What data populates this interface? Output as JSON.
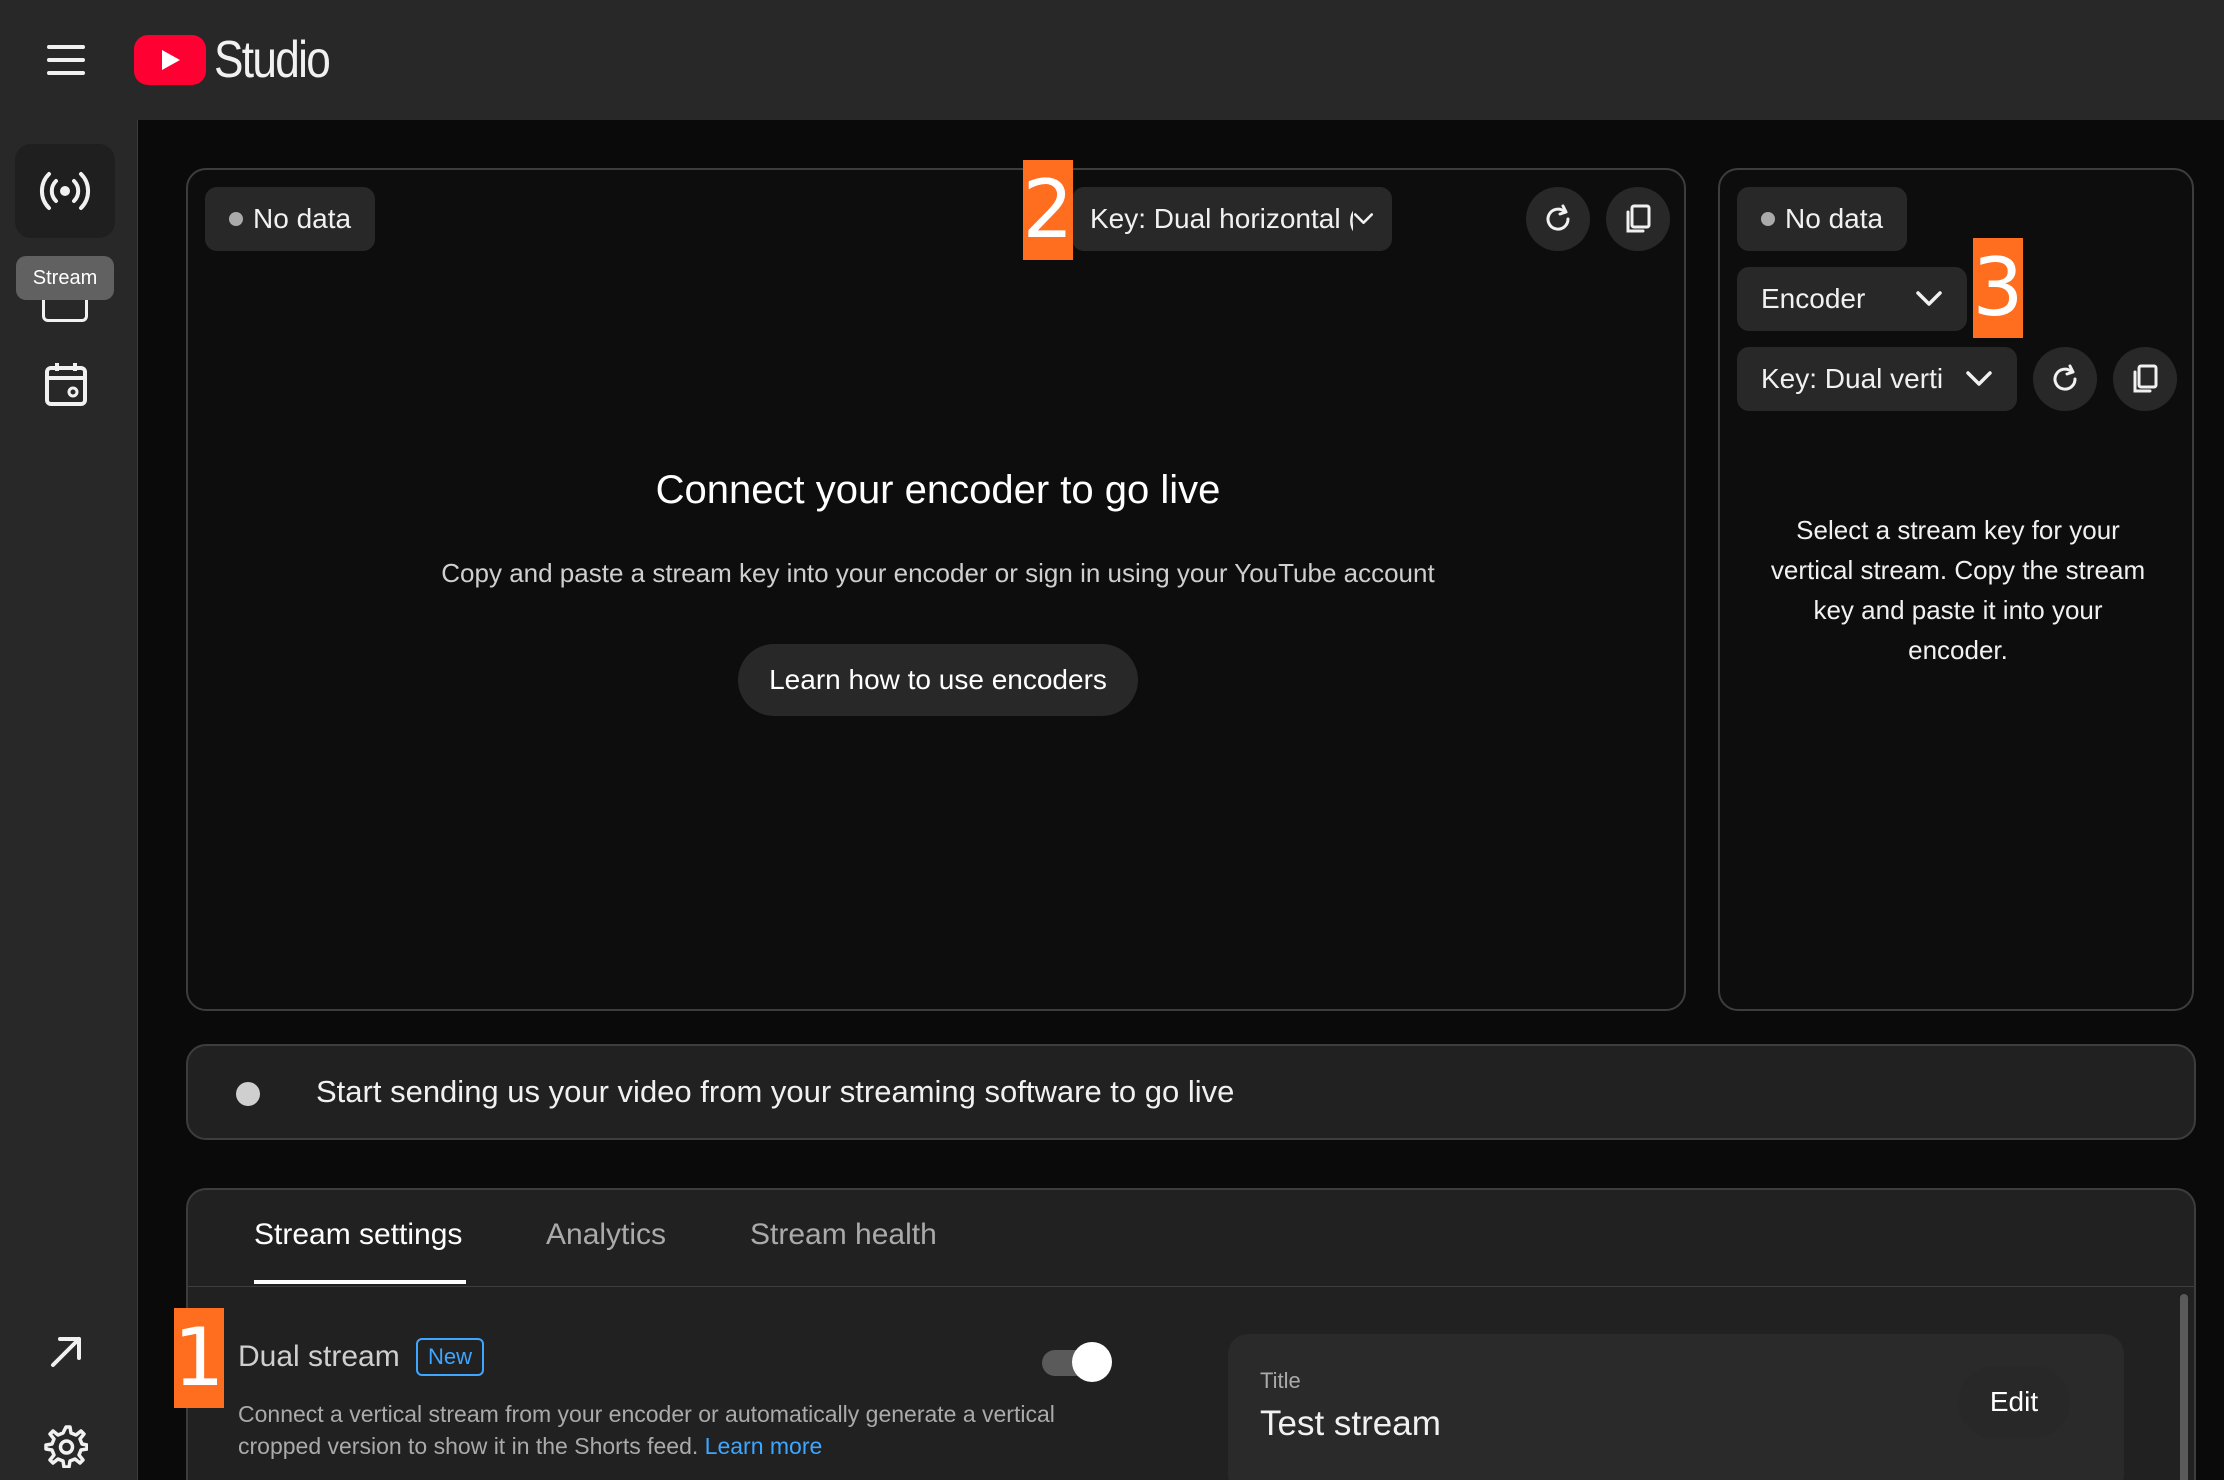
{
  "app": {
    "logo_text": "Studio"
  },
  "sidebar": {
    "tooltip": "Stream"
  },
  "preview_main": {
    "health_chip": "No data",
    "key_select": "Key: Dual horizontal (RTMP,",
    "title": "Connect your encoder to go live",
    "subtitle": "Copy and paste a stream key into your encoder or sign in using your YouTube account",
    "learn_button": "Learn how to use encoders"
  },
  "preview_vertical": {
    "health_chip": "No data",
    "source_select": "Encoder",
    "key_select": "Key: Dual verti",
    "message": "Select a stream key for your vertical stream. Copy the stream key and paste it into your encoder."
  },
  "status": {
    "message": "Start sending us your video from your streaming software to go live"
  },
  "tabs": [
    {
      "label": "Stream settings",
      "active": true
    },
    {
      "label": "Analytics",
      "active": false
    },
    {
      "label": "Stream health",
      "active": false
    }
  ],
  "dual_stream": {
    "label": "Dual stream",
    "badge": "New",
    "enabled": true,
    "description": "Connect a vertical stream from your encoder or automatically generate a vertical cropped version to show it in the Shorts feed.",
    "learn_more": "Learn more"
  },
  "details": {
    "title_label": "Title",
    "title_value": "Test stream",
    "edit_label": "Edit"
  },
  "annotations": {
    "one": "1",
    "two": "2",
    "three": "3"
  },
  "colors": {
    "brand": "#ff0033",
    "annotation": "#ff6d1f",
    "link": "#3ea6ff",
    "background": "#0a0a0a",
    "surface": "#282828"
  },
  "icons": {
    "menu": "menu-icon",
    "stream": "live-broadcast-icon",
    "calendar": "calendar-icon",
    "external": "arrow-up-right-icon",
    "settings": "gear-icon",
    "refresh": "refresh-icon",
    "copy": "copy-icon",
    "dropdown": "chevron-down-icon"
  }
}
